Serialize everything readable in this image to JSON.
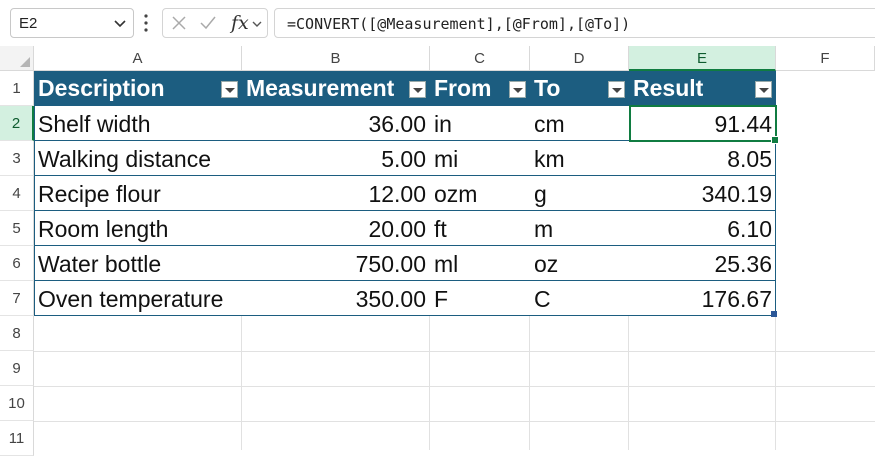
{
  "formula_bar": {
    "name_box": "E2",
    "fx_label": "fx",
    "formula": "=CONVERT([@Measurement],[@From],[@To])"
  },
  "columns": [
    "A",
    "B",
    "C",
    "D",
    "E",
    "F"
  ],
  "rows": [
    "1",
    "2",
    "3",
    "4",
    "5",
    "6",
    "7",
    "8",
    "9",
    "10",
    "11"
  ],
  "selected": {
    "column": "E",
    "row": "2"
  },
  "table": {
    "header_color": "#1c5d80",
    "headers": [
      "Description",
      "Measurement",
      "From",
      "To",
      "Result"
    ],
    "data": [
      [
        "Shelf width",
        "36.00",
        "in",
        "cm",
        "91.44"
      ],
      [
        "Walking distance",
        "5.00",
        "mi",
        "km",
        "8.05"
      ],
      [
        "Recipe flour",
        "12.00",
        "ozm",
        "g",
        "340.19"
      ],
      [
        "Room length",
        "20.00",
        "ft",
        "m",
        "6.10"
      ],
      [
        "Water bottle",
        "750.00",
        "ml",
        "oz",
        "25.36"
      ],
      [
        "Oven temperature",
        "350.00",
        "F",
        "C",
        "176.67"
      ]
    ]
  },
  "icons": {
    "name_box_dropdown": "chevron-down-icon",
    "more": "vertical-dots-icon",
    "cancel": "close-icon",
    "enter": "check-icon",
    "function": "fx-icon",
    "filter": "filter-dropdown-icon"
  }
}
